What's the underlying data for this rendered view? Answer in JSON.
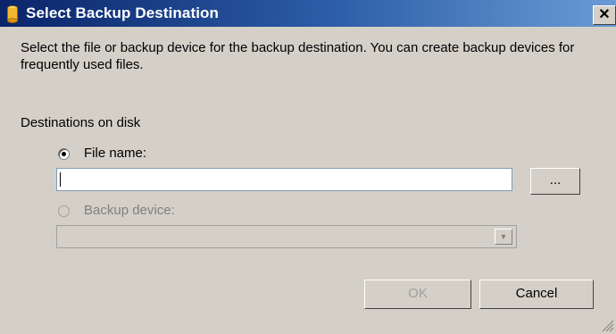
{
  "window": {
    "title": "Select Backup Destination",
    "close_label": "✕"
  },
  "dialog": {
    "description": "Select the file or backup device for the backup destination. You can create backup devices for frequently used files.",
    "section_label": "Destinations on disk",
    "file_name_label": "File name:",
    "file_name_value": "",
    "file_name_selected": true,
    "browse_label": "...",
    "backup_device_label": "Backup device:",
    "backup_device_value": "",
    "dropdown_arrow": "▼",
    "ok_label": "OK",
    "cancel_label": "Cancel"
  }
}
